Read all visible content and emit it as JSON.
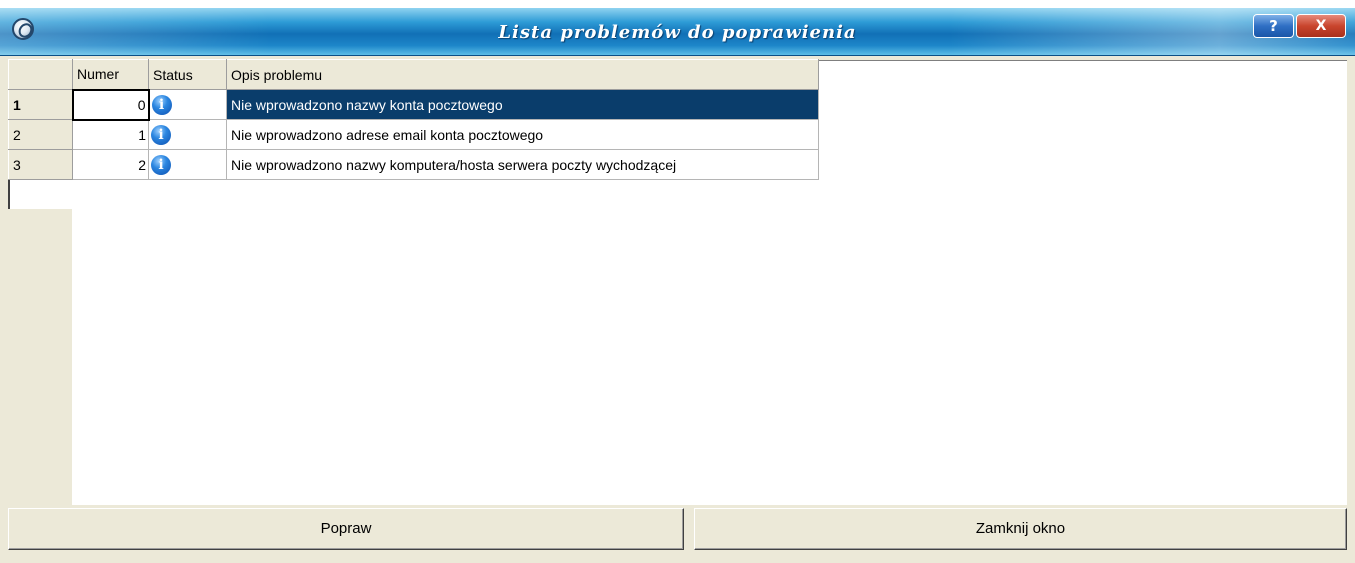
{
  "window": {
    "title": "Lista problemów do poprawienia",
    "help_label": "?",
    "close_label": "X"
  },
  "grid": {
    "columns": [
      "",
      "Numer",
      "Status",
      "Opis problemu"
    ],
    "rows": [
      {
        "row_no": "1",
        "numer": "0",
        "status_icon": "info-icon",
        "opis": "Nie wprowadzono nazwy konta pocztowego",
        "selected": true
      },
      {
        "row_no": "2",
        "numer": "1",
        "status_icon": "info-icon",
        "opis": "Nie wprowadzono adrese email konta pocztowego",
        "selected": false
      },
      {
        "row_no": "3",
        "numer": "2",
        "status_icon": "info-icon",
        "opis": "Nie wprowadzono nazwy komputera/hosta serwera poczty wychodzącej",
        "selected": false
      }
    ]
  },
  "buttons": {
    "popraw": "Popraw",
    "zamknij": "Zamknij okno"
  },
  "colors": {
    "selection": "#0a3d6b",
    "titlebar": "#1170b6",
    "face": "#ece9d8"
  }
}
